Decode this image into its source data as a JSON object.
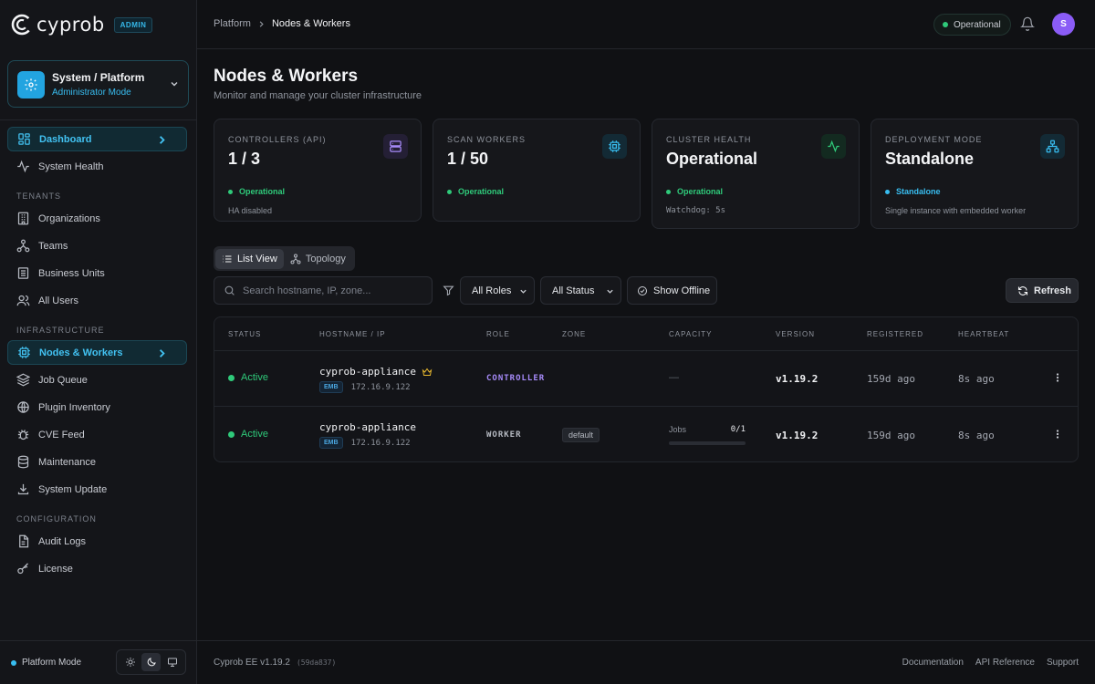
{
  "brand": {
    "name": "cyprob",
    "badge": "ADMIN"
  },
  "context": {
    "title": "System / Platform",
    "subtitle": "Administrator Mode"
  },
  "sidebar": {
    "top_items": [
      {
        "label": "Dashboard",
        "icon": "dashboard-icon",
        "active": true
      },
      {
        "label": "System Health",
        "icon": "activity-icon"
      }
    ],
    "sections": [
      {
        "title": "TENANTS",
        "items": [
          {
            "label": "Organizations",
            "icon": "building-icon"
          },
          {
            "label": "Teams",
            "icon": "network-icon"
          },
          {
            "label": "Business Units",
            "icon": "grid-icon"
          },
          {
            "label": "All Users",
            "icon": "users-icon"
          }
        ]
      },
      {
        "title": "INFRASTRUCTURE",
        "items": [
          {
            "label": "Nodes & Workers",
            "icon": "cpu-icon",
            "active": true
          },
          {
            "label": "Job Queue",
            "icon": "layers-icon"
          },
          {
            "label": "Plugin Inventory",
            "icon": "globe-icon"
          },
          {
            "label": "CVE Feed",
            "icon": "bug-icon"
          },
          {
            "label": "Maintenance",
            "icon": "database-icon"
          },
          {
            "label": "System Update",
            "icon": "download-icon"
          }
        ]
      },
      {
        "title": "CONFIGURATION",
        "items": [
          {
            "label": "Audit Logs",
            "icon": "file-icon"
          },
          {
            "label": "License",
            "icon": "key-icon"
          }
        ]
      }
    ],
    "footer": {
      "mode_label": "Platform Mode",
      "theme_selected": "dark"
    }
  },
  "header": {
    "breadcrumb": [
      "Platform",
      "Nodes & Workers"
    ],
    "status": "Operational",
    "avatar_initial": "S"
  },
  "page": {
    "title": "Nodes & Workers",
    "subtitle": "Monitor and manage your cluster infrastructure"
  },
  "stats": [
    {
      "label": "CONTROLLERS (API)",
      "value": "1 / 3",
      "status": "Operational",
      "status_color": "#2fca7a",
      "note": "HA disabled",
      "icon": "server-icon",
      "icon_color": "#a78bfa"
    },
    {
      "label": "SCAN WORKERS",
      "value": "1 / 50",
      "status": "Operational",
      "status_color": "#2fca7a",
      "note": "",
      "icon": "cpu-icon",
      "icon_color": "#38bdf0"
    },
    {
      "label": "CLUSTER HEALTH",
      "value": "Operational",
      "status": "Operational",
      "status_color": "#2fca7a",
      "note": "Watchdog: 5s",
      "icon": "activity-icon",
      "icon_color": "#2fca7a"
    },
    {
      "label": "DEPLOYMENT MODE",
      "value": "Standalone",
      "status": "Standalone",
      "status_color": "#38bdf0",
      "note": "Single instance with embedded worker",
      "icon": "network-icon",
      "icon_color": "#38bdf0"
    }
  ],
  "toolbar": {
    "views": [
      "List View",
      "Topology"
    ],
    "selected_view": "List View",
    "search_placeholder": "Search hostname, IP, zone...",
    "role_filter": "All Roles",
    "status_filter": "All Status",
    "show_offline": "Show Offline",
    "refresh": "Refresh"
  },
  "table": {
    "columns": [
      "STATUS",
      "HOSTNAME / IP",
      "ROLE",
      "ZONE",
      "CAPACITY",
      "VERSION",
      "REGISTERED",
      "HEARTBEAT"
    ],
    "rows": [
      {
        "status": "Active",
        "hostname": "cyprob-appliance",
        "crown": true,
        "tag": "EMB",
        "ip": "172.16.9.122",
        "role": "CONTROLLER",
        "role_color": "#a78bfa",
        "zone": "",
        "capacity": "—",
        "version": "v1.19.2",
        "registered": "159d ago",
        "heartbeat": "8s ago"
      },
      {
        "status": "Active",
        "hostname": "cyprob-appliance",
        "crown": false,
        "tag": "EMB",
        "ip": "172.16.9.122",
        "role": "WORKER",
        "role_color": "#b6bac2",
        "zone": "default",
        "capacity_label": "Jobs",
        "capacity_value": "0/1",
        "capacity_fraction": 0,
        "version": "v1.19.2",
        "registered": "159d ago",
        "heartbeat": "8s ago"
      }
    ]
  },
  "footer": {
    "version": "Cyprob EE v1.19.2",
    "hash": "(59da837)",
    "links": [
      "Documentation",
      "API Reference",
      "Support"
    ]
  }
}
